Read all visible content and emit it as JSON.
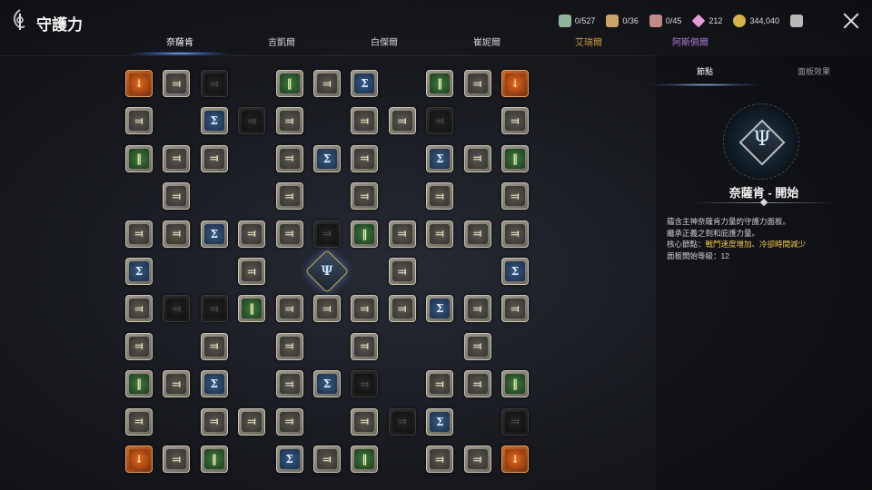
{
  "header": {
    "title": "守護力",
    "resources": [
      {
        "icon": "map-scroll-icon",
        "value": "0/527",
        "color": "#8fb59a"
      },
      {
        "icon": "book-icon",
        "value": "0/36",
        "color": "#c9a36a"
      },
      {
        "icon": "crest-icon",
        "value": "0/45",
        "color": "#c08a8a"
      },
      {
        "icon": "crystal-icon",
        "value": "212",
        "color": "#e59ad8"
      },
      {
        "icon": "gold-coin-icon",
        "value": "344,040",
        "color": "#d8b24a"
      },
      {
        "icon": "teacup-icon",
        "value": "",
        "color": "#b8b8b8"
      }
    ]
  },
  "tabs": [
    {
      "label": "奈薩肯",
      "active": true,
      "color": "white"
    },
    {
      "label": "吉凱爾",
      "active": false,
      "color": "white"
    },
    {
      "label": "白傑爾",
      "active": false,
      "color": "white"
    },
    {
      "label": "崔妮爾",
      "active": false,
      "color": "white"
    },
    {
      "label": "艾瑞爾",
      "active": false,
      "color": "gold"
    },
    {
      "label": "阿斯佩爾",
      "active": false,
      "color": "purple"
    }
  ],
  "grid": {
    "rows": 11,
    "cols": 11,
    "cells": [
      "O G D . N G B . N G O",
      "G . B D G . G G D . G",
      "N G G . G B G . B G N",
      ". G . . G . G . G . G",
      "G G B G G D N G G G G",
      "B . . G . C . G . . B",
      "G D D N G G G G B G G",
      "G . G . G . G . . G .",
      "N G B . G B D . G G N",
      "G . G G G . G D B . D",
      "O G N . B G N . G G O"
    ],
    "legend": {
      "G": "gray-node",
      "B": "blue-node",
      "N": "green-node",
      "O": "orange-node",
      "D": "locked-node",
      "C": "center-node",
      ".": "empty"
    },
    "glyphs": {
      "G": "⫤",
      "B": "Σ",
      "N": "‖",
      "O": "↓",
      "D": "⫤",
      "C": "Ψ"
    }
  },
  "panel": {
    "tabs": [
      {
        "label": "節點",
        "active": true
      },
      {
        "label": "面板效果",
        "active": false
      }
    ],
    "node_name": "奈薩肯 - 開始",
    "description": {
      "line1": "蘊含主神奈薩肯力量的守護力面板。",
      "line2": "繼承正義之劍和庇護力量。",
      "line3_prefix": "核心節點：",
      "line3_highlight1": "戰鬥速度增加",
      "line3_sep": "、",
      "line3_highlight2": "冷卻時間減少",
      "line4": "面板開始等級：12"
    }
  }
}
